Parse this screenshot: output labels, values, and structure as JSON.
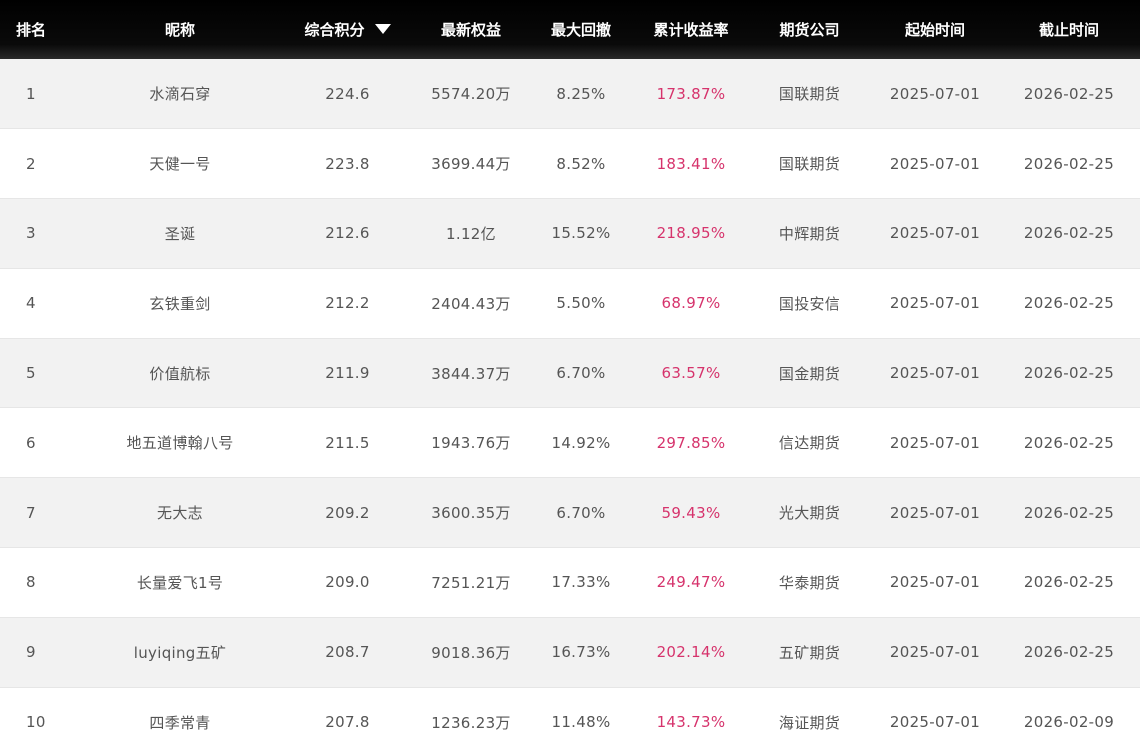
{
  "table": {
    "headers": {
      "rank": "排名",
      "nickname": "昵称",
      "score": "综合积分",
      "equity": "最新权益",
      "drawdown": "最大回撤",
      "return": "累计收益率",
      "broker": "期货公司",
      "start": "起始时间",
      "end": "截止时间"
    },
    "sort_icon": "caret-down-icon",
    "return_color": "#d6336c",
    "rows": [
      {
        "rank": "1",
        "nickname": "水滴石穿",
        "score": "224.6",
        "equity": "5574.20万",
        "drawdown": "8.25%",
        "return": "173.87%",
        "broker": "国联期货",
        "start": "2025-07-01",
        "end": "2026-02-25"
      },
      {
        "rank": "2",
        "nickname": "天健一号",
        "score": "223.8",
        "equity": "3699.44万",
        "drawdown": "8.52%",
        "return": "183.41%",
        "broker": "国联期货",
        "start": "2025-07-01",
        "end": "2026-02-25"
      },
      {
        "rank": "3",
        "nickname": "圣诞",
        "score": "212.6",
        "equity": "1.12亿",
        "drawdown": "15.52%",
        "return": "218.95%",
        "broker": "中辉期货",
        "start": "2025-07-01",
        "end": "2026-02-25"
      },
      {
        "rank": "4",
        "nickname": "玄铁重剑",
        "score": "212.2",
        "equity": "2404.43万",
        "drawdown": "5.50%",
        "return": "68.97%",
        "broker": "国投安信",
        "start": "2025-07-01",
        "end": "2026-02-25"
      },
      {
        "rank": "5",
        "nickname": "价值航标",
        "score": "211.9",
        "equity": "3844.37万",
        "drawdown": "6.70%",
        "return": "63.57%",
        "broker": "国金期货",
        "start": "2025-07-01",
        "end": "2026-02-25"
      },
      {
        "rank": "6",
        "nickname": "地五道博翰八号",
        "score": "211.5",
        "equity": "1943.76万",
        "drawdown": "14.92%",
        "return": "297.85%",
        "broker": "信达期货",
        "start": "2025-07-01",
        "end": "2026-02-25"
      },
      {
        "rank": "7",
        "nickname": "无大志",
        "score": "209.2",
        "equity": "3600.35万",
        "drawdown": "6.70%",
        "return": "59.43%",
        "broker": "光大期货",
        "start": "2025-07-01",
        "end": "2026-02-25"
      },
      {
        "rank": "8",
        "nickname": "长量爱飞1号",
        "score": "209.0",
        "equity": "7251.21万",
        "drawdown": "17.33%",
        "return": "249.47%",
        "broker": "华泰期货",
        "start": "2025-07-01",
        "end": "2026-02-25"
      },
      {
        "rank": "9",
        "nickname": "luyiqing五矿",
        "score": "208.7",
        "equity": "9018.36万",
        "drawdown": "16.73%",
        "return": "202.14%",
        "broker": "五矿期货",
        "start": "2025-07-01",
        "end": "2026-02-25"
      },
      {
        "rank": "10",
        "nickname": "四季常青",
        "score": "207.8",
        "equity": "1236.23万",
        "drawdown": "11.48%",
        "return": "143.73%",
        "broker": "海证期货",
        "start": "2025-07-01",
        "end": "2026-02-09"
      }
    ]
  }
}
